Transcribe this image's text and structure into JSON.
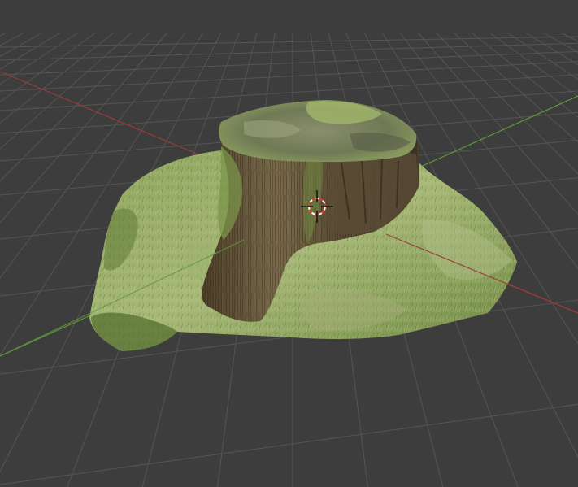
{
  "viewport": {
    "background": "#3d3d3d",
    "grid_color": "#555555",
    "axis_x_color": "#9a3b3b",
    "axis_y_color": "#5e9a3a",
    "cursor_color_primary": "#e33b2b",
    "cursor_color_secondary": "#ffffff"
  },
  "scene": {
    "object": "tree-stump-scan",
    "moss_colors": [
      "#7d9a4e",
      "#9bb06a",
      "#5f7a36",
      "#b3c088"
    ],
    "bark_colors": [
      "#6b5a3e",
      "#4f422c",
      "#8a7a5a",
      "#3d3424"
    ]
  }
}
